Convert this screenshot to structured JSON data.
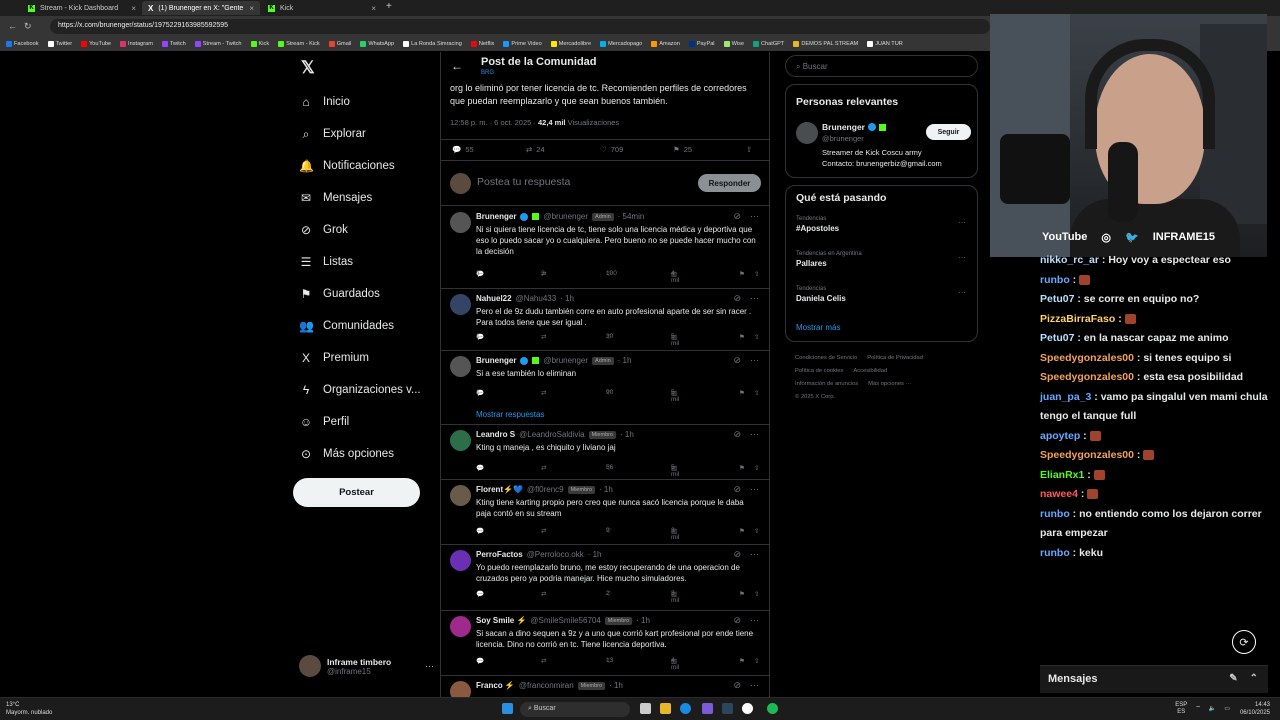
{
  "browser": {
    "tabs": [
      {
        "label": "Stream - Kick Dashboard",
        "icon": "kick"
      },
      {
        "label": "(1) Brunenger en X: \"Gente me b...",
        "icon": "x"
      },
      {
        "label": "Kick",
        "icon": "kick"
      }
    ],
    "url": "https://x.com/brunenger/status/1975229163985592595",
    "bookmarks": [
      "Facebook",
      "Twitter",
      "YouTube",
      "Instagram",
      "Twitch",
      "Stream - Twitch",
      "Kick",
      "Stream - Kick",
      "Gmail",
      "WhatsApp",
      "La Ronda Simracing",
      "Netflix",
      "Prime Video",
      "Mercadolibre",
      "Mercadopago",
      "Amazon",
      "PayPal",
      "Wise",
      "ChatGPT",
      "DEMOS PAL STREAM",
      "JUAN TUR"
    ]
  },
  "nav": {
    "items": [
      {
        "label": "Inicio",
        "icon": "⌂"
      },
      {
        "label": "Explorar",
        "icon": "⌕"
      },
      {
        "label": "Notificaciones",
        "icon": "🔔"
      },
      {
        "label": "Mensajes",
        "icon": "✉"
      },
      {
        "label": "Grok",
        "icon": "⊘"
      },
      {
        "label": "Listas",
        "icon": "☰"
      },
      {
        "label": "Guardados",
        "icon": "⚑"
      },
      {
        "label": "Comunidades",
        "icon": "👥"
      },
      {
        "label": "Premium",
        "icon": "X"
      },
      {
        "label": "Organizaciones v...",
        "icon": "ϟ"
      },
      {
        "label": "Perfil",
        "icon": "☺"
      },
      {
        "label": "Más opciones",
        "icon": "⊙"
      }
    ],
    "post_button": "Postear",
    "profile": {
      "name": "Inframe timbero",
      "handle": "@inframe15"
    }
  },
  "post": {
    "header_title": "Post de la Comunidad",
    "header_sub": "BRG",
    "text": "org lo eliminó por tener licencia de tc. Recomienden perfiles de corredores que puedan reemplazarlo y que sean buenos también.",
    "time": "12:58 p. m. · 6 oct. 2025 ·",
    "views": "42,4 mil",
    "views_label": "Visualizaciones",
    "stats": {
      "replies": "55",
      "reposts": "24",
      "likes": "709",
      "bookmarks": "25"
    },
    "reply_placeholder": "Postea tu respuesta",
    "reply_button": "Responder"
  },
  "replies": [
    {
      "name": "Brunenger",
      "handle": "@brunenger",
      "tag": "Admin",
      "time": "· 54min",
      "text": "Ni si quiera tiene licencia de tc, tiene solo una licencia médica y deportiva que  eso lo puedo sacar yo o cualquiera. Pero bueno no se puede hacer mucho con la decisión",
      "replies": "3",
      "reposts": "3",
      "likes": "100",
      "views": "4 mil"
    },
    {
      "name": "Nahuel22",
      "handle": "@Nahu433",
      "tag": "",
      "time": "· 1h",
      "text": "Pero el de 9z dudu también corre en auto profesional aparte de ser sin racer . Para todos tiene que ser igual .",
      "replies": "1",
      "reposts": "",
      "likes": "30",
      "views": "5 mil"
    },
    {
      "name": "Brunenger",
      "handle": "@brunenger",
      "tag": "Admin",
      "time": "· 1h",
      "text": "Si a ese también lo eliminan",
      "replies": "1",
      "reposts": "",
      "likes": "90",
      "views": "5 mil"
    },
    {
      "name": "Leandro S",
      "handle": "@LeandroSaldivia",
      "tag": "Miembro",
      "time": "· 1h",
      "text": "Kting q maneja , es chiquito y liviano jaj",
      "replies": "",
      "reposts": "",
      "likes": "56",
      "views": "5 mil"
    },
    {
      "name": "Florent⚡💙",
      "handle": "@fl0renc9",
      "tag": "Miembro",
      "time": "· 1h",
      "text": "Kting tiene karting propio pero creo que nunca sacó licencia porque le daba paja contó en su stream",
      "replies": "",
      "reposts": "",
      "likes": "9",
      "views": "3 mil"
    },
    {
      "name": "PerroFactos",
      "handle": "@Perroloco.okk",
      "tag": "",
      "time": "· 1h",
      "text": "Yo puedo reemplazarlo bruno, me estoy recuperando de una operacion de cruzados pero ya podria manejar. Hice mucho simuladores.",
      "replies": "",
      "reposts": "",
      "likes": "2",
      "views": "3 mil"
    },
    {
      "name": "Soy Smile ⚡",
      "handle": "@SmileSmile56704",
      "tag": "Miembro",
      "time": "· 1h",
      "text": "Si sacan a dino sequen a 9z y a uno que corrió kart profesional por ende tiene licencia. Dino no corrió en tc. Tiene licencia deportiva.",
      "replies": "",
      "reposts": "",
      "likes": "13",
      "views": "4 mil"
    },
    {
      "name": "Franco ⚡",
      "handle": "@franconmiran",
      "tag": "Miembro",
      "time": "· 1h",
      "text": "",
      "replies": "",
      "reposts": "",
      "likes": "",
      "views": ""
    }
  ],
  "show_more": "Mostrar respuestas",
  "right": {
    "search_placeholder": "Buscar",
    "relevant_title": "Personas relevantes",
    "person": {
      "name": "Brunenger",
      "handle": "@brunenger",
      "follow": "Seguir",
      "bio1": "Streamer de Kick Coscu army",
      "bio2": "Contacto: brunengerbiz@gmail.com"
    },
    "trending_title": "Qué está pasando",
    "trends": [
      {
        "context": "Tendencias",
        "name": "#Apostoles"
      },
      {
        "context": "Tendencias en Argentina",
        "name": "Pallares"
      },
      {
        "context": "Tendencias",
        "name": "Daniela Celis"
      }
    ],
    "show_more": "Mostrar más",
    "footer": [
      "Condiciones de Servicio",
      "Política de Privacidad",
      "Política de cookies",
      "Accesibilidad",
      "Información de anuncios",
      "Más opciones ···",
      "© 2025 X Corp."
    ]
  },
  "stream": {
    "socials": [
      "YouTube",
      "INFRAME15"
    ],
    "chat": [
      {
        "user": "nikko_rc_ar",
        "color": "#b8e0ff",
        "text": "Hoy voy a espectear eso",
        "emote": false
      },
      {
        "user": "runbo",
        "color": "#69a8ff",
        "text": "",
        "emote": true
      },
      {
        "user": "Petu07",
        "color": "#b8e0ff",
        "text": "se corre en equipo no?",
        "emote": false
      },
      {
        "user": "PizzaBirraFaso",
        "color": "#ffd166",
        "text": "",
        "emote": true
      },
      {
        "user": "Petu07",
        "color": "#b8e0ff",
        "text": "en la nascar capaz me animo",
        "emote": false
      },
      {
        "user": "Speedygonzales00",
        "color": "#f4a259",
        "text": "si tenes equipo si",
        "emote": false
      },
      {
        "user": "Speedygonzales00",
        "color": "#f4a259",
        "text": "esta esa posibilidad",
        "emote": false
      },
      {
        "user": "juan_pa_3",
        "color": "#69a8ff",
        "text": "vamo pa singalul ven mami chula tengo el tanque full",
        "emote": false
      },
      {
        "user": "apoytep",
        "color": "#69a8ff",
        "text": "",
        "emote": true
      },
      {
        "user": "Speedygonzales00",
        "color": "#f4a259",
        "text": "",
        "emote": true
      },
      {
        "user": "ElianRx1",
        "color": "#53fc18",
        "text": "",
        "emote": true
      },
      {
        "user": "nawee4",
        "color": "#ff5a5a",
        "text": "",
        "emote": true
      },
      {
        "user": "runbo",
        "color": "#69a8ff",
        "text": "no entiendo como los dejaron correr para empezar",
        "emote": false
      },
      {
        "user": "runbo",
        "color": "#69a8ff",
        "text": "keku",
        "emote": false
      }
    ],
    "chat_title": "Mensajes"
  },
  "taskbar": {
    "weather_temp": "13°C",
    "weather_desc": "Mayorm. nublado",
    "search": "Buscar",
    "lang1": "ESP",
    "lang2": "ES",
    "time": "14:43",
    "date": "06/10/2025"
  },
  "colors": {
    "accent": "#1d9bf0",
    "kick": "#53fc18"
  }
}
